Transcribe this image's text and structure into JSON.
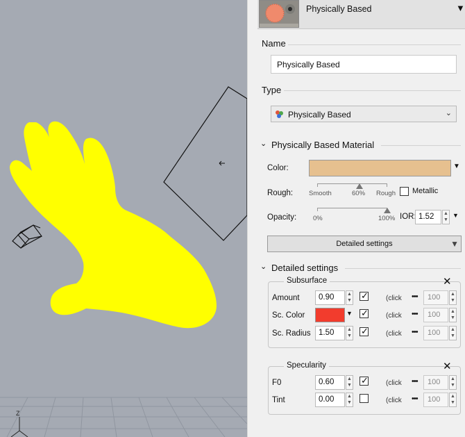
{
  "viewport": {
    "axis_label": "Z"
  },
  "header": {
    "material_name": "Physically Based",
    "dropdown_icon": "triangle-down-icon"
  },
  "name_section": {
    "label": "Name",
    "value": "Physically Based"
  },
  "type_section": {
    "label": "Type",
    "selected": "Physically Based",
    "icon": "material-type-icon"
  },
  "pbr_section": {
    "title": "Physically Based Material",
    "color_label": "Color:",
    "color_value": "#e6c08f",
    "rough_label": "Rough:",
    "rough_ticks": [
      "Smooth",
      "60%",
      "Rough"
    ],
    "rough_level": 0.6,
    "metallic_label": "Metallic",
    "metallic_checked": false,
    "opacity_label": "Opacity:",
    "opacity_ticks": [
      "0%",
      "100%"
    ],
    "opacity_level": 1.0,
    "ior_label": "IOR:",
    "ior_value": "1.52",
    "detailed_button": "Detailed settings"
  },
  "detailed_section": {
    "title": "Detailed settings",
    "subsurface": {
      "title": "Subsurface",
      "rows": [
        {
          "label": "Amount",
          "value": "0.90",
          "checked": true,
          "click": "(click",
          "dots": "•••",
          "num": "100"
        },
        {
          "label": "Sc. Color",
          "value": "",
          "color": "#f23c2d",
          "checked": true,
          "click": "(click",
          "dots": "•••",
          "num": "100"
        },
        {
          "label": "Sc. Radius",
          "value": "1.50",
          "checked": true,
          "click": "(click",
          "dots": "•••",
          "num": "100"
        }
      ]
    },
    "specularity": {
      "title": "Specularity",
      "rows": [
        {
          "label": "F0",
          "value": "0.60",
          "checked": true,
          "click": "(click",
          "dots": "•••",
          "num": "100"
        },
        {
          "label": "Tint",
          "value": "0.00",
          "checked": false,
          "click": "(click",
          "dots": "•••",
          "num": "100"
        }
      ]
    }
  }
}
